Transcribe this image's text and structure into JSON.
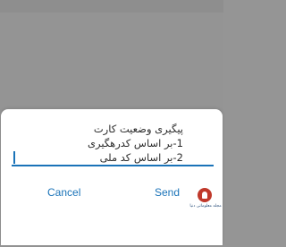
{
  "dialog": {
    "message_lines": [
      "پیگیری وضعیت کارت",
      "1-بر اساس کدرهگیری",
      "2-بر اساس کد ملی"
    ],
    "input": {
      "value": "",
      "placeholder": ""
    },
    "buttons": {
      "cancel_label": "Cancel",
      "send_label": "Send"
    }
  },
  "watermark": {
    "text": "مجله معلوماتی دنیا"
  },
  "colors": {
    "accent": "#1a73b8",
    "backdrop": "#949494",
    "dialog_bg": "#ffffff"
  },
  "icons": {
    "watermark_logo": "brand-logo-icon"
  }
}
